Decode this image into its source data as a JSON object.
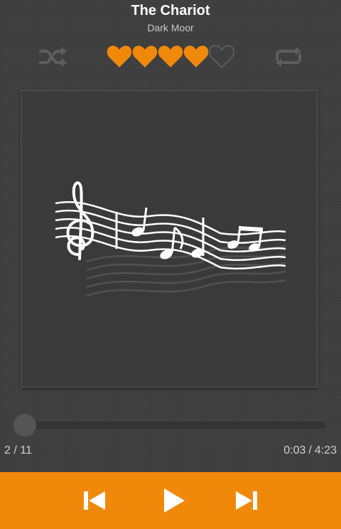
{
  "now_playing": {
    "title": "The Chariot",
    "artist": "Dark Moor"
  },
  "controls": {
    "shuffle_icon": "shuffle-icon",
    "repeat_icon": "repeat-icon"
  },
  "rating": {
    "value": 4,
    "max": 5,
    "filled_color": "#f0890a",
    "empty_color": "#5a5a5a"
  },
  "album_art": {
    "icon": "music-notes-icon"
  },
  "playback": {
    "progress_fraction": 0.01,
    "track_position": "2 / 11",
    "elapsed": "0:03",
    "separator": "/",
    "duration": "4:23"
  },
  "transport": {
    "previous_icon": "skip-previous-icon",
    "play_icon": "play-icon",
    "next_icon": "skip-next-icon",
    "bar_color": "#f0890a"
  }
}
